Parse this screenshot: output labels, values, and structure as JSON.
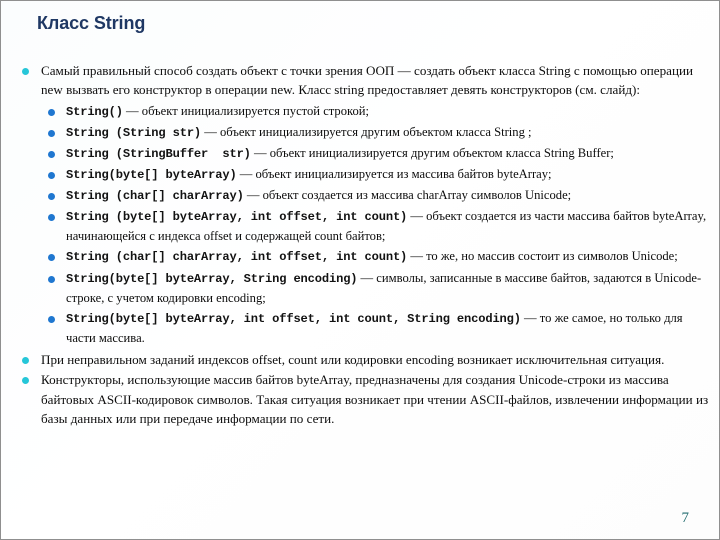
{
  "slide": {
    "title": "Класс String",
    "page_number": "7",
    "colors": {
      "title": "#1f3864",
      "bullet_level1": "#26c6d8",
      "bullet_level2": "#1f77d0",
      "page_number": "#1f6b6e",
      "body_text": "#0d0d0d"
    }
  },
  "intro": {
    "text": "Самый правильный способ создать объект с точки зрения ООП — создать объект класса String  с помощью операции new вызвать его конструктор в операции new. Класс string предоставляет девять конструкторов (см. слайд):"
  },
  "constructors": [
    {
      "signature": "String()",
      "description": " — объект инициализируется  пустой строкой;"
    },
    {
      "signature": "String (String str)",
      "description": " — объект инициализируется  другим объектом класса String ;"
    },
    {
      "signature": "String (StringBuffer  str)",
      "description": " — объект инициализируется  другим объектом класса String Buffer;"
    },
    {
      "signature": "String(byte[] byteArray)",
      "description": " — объект инициализируется  из массива байтов byteArray;"
    },
    {
      "signature": "String (char[] charArray)",
      "description": " — объект создается из массива charArray символов Unicode;"
    },
    {
      "signature": "String (byte[] byteArray, int offset, int count)",
      "description": " — объект создается из части массива байтов byteArray, начинающейся с индекса offset и содержащей count байтов;"
    },
    {
      "signature": "String (char[] charArray, int offset, int count)",
      "description": " — то же, но массив состоит из символов Unicode;"
    },
    {
      "signature": "String(byte[] byteArray, String encoding)",
      "description": " — символы, записанные в массиве байтов, задаются в Unicode-строке, с учетом кодировки encoding;"
    },
    {
      "signature": "String(byte[] byteArray, int offset, int count, String encoding)",
      "description": " — то же самое, но только для части массива."
    }
  ],
  "notes": [
    {
      "text": "При неправильном заданий индексов offset, count или кодировки encoding возникает исключительная ситуация."
    },
    {
      "text": "Конструкторы, использующие массив байтов byteArray, предназначены для создания Unicode-строки из массива байтовых ASCII-кодировок символов. Такая ситуация возникает при чтении ASCII-файлов, извлечении информации из базы данных или при передаче информации по сети."
    }
  ]
}
